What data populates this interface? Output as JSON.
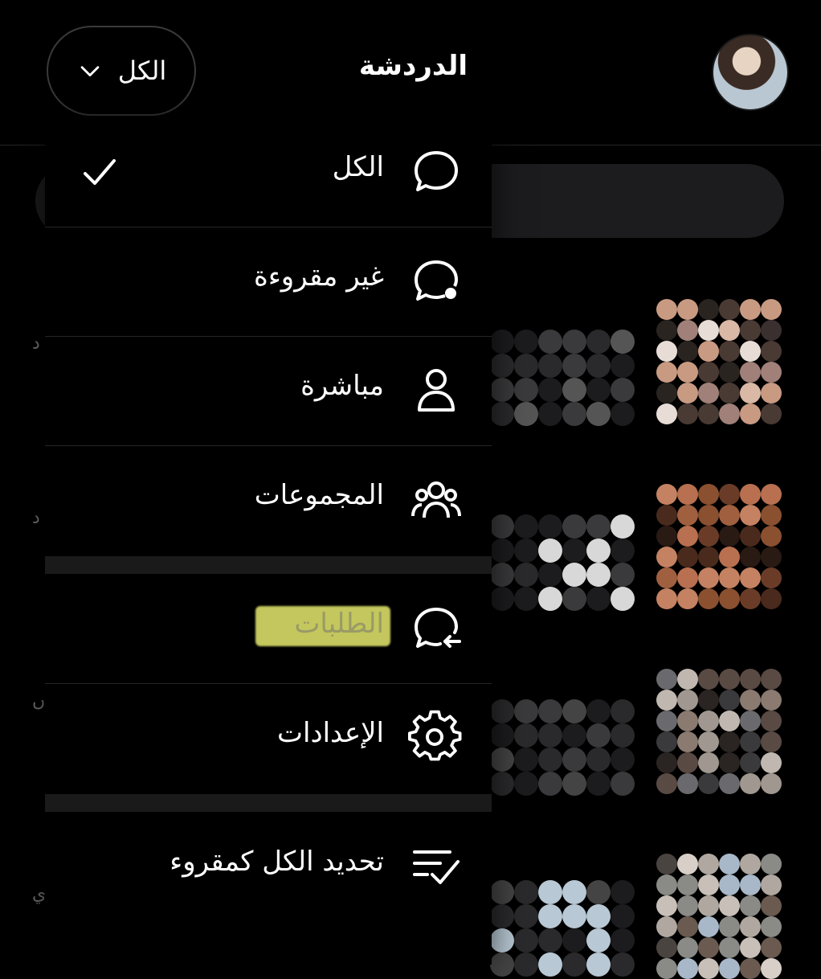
{
  "header": {
    "title": "الدردشة",
    "filter_label": "الكل"
  },
  "menu": {
    "items": [
      {
        "label": "الكل",
        "icon": "chat-bubble-icon",
        "selected": true
      },
      {
        "label": "غير مقروءة",
        "icon": "chat-unread-icon"
      },
      {
        "label": "مباشرة",
        "icon": "person-icon"
      },
      {
        "label": "المجموعات",
        "icon": "group-icon"
      },
      {
        "label": "الطلبات",
        "icon": "chat-request-icon",
        "highlight_color": "#dfe36a"
      },
      {
        "label": "الإعدادات",
        "icon": "gear-icon"
      },
      {
        "label": "تحديد الكل كمقروء",
        "icon": "mark-all-read-icon"
      }
    ]
  },
  "colors": {
    "background": "#000000",
    "menu_divider": "#262626",
    "section_separator": "#1a1a1a",
    "highlight": "#dfe36a"
  }
}
